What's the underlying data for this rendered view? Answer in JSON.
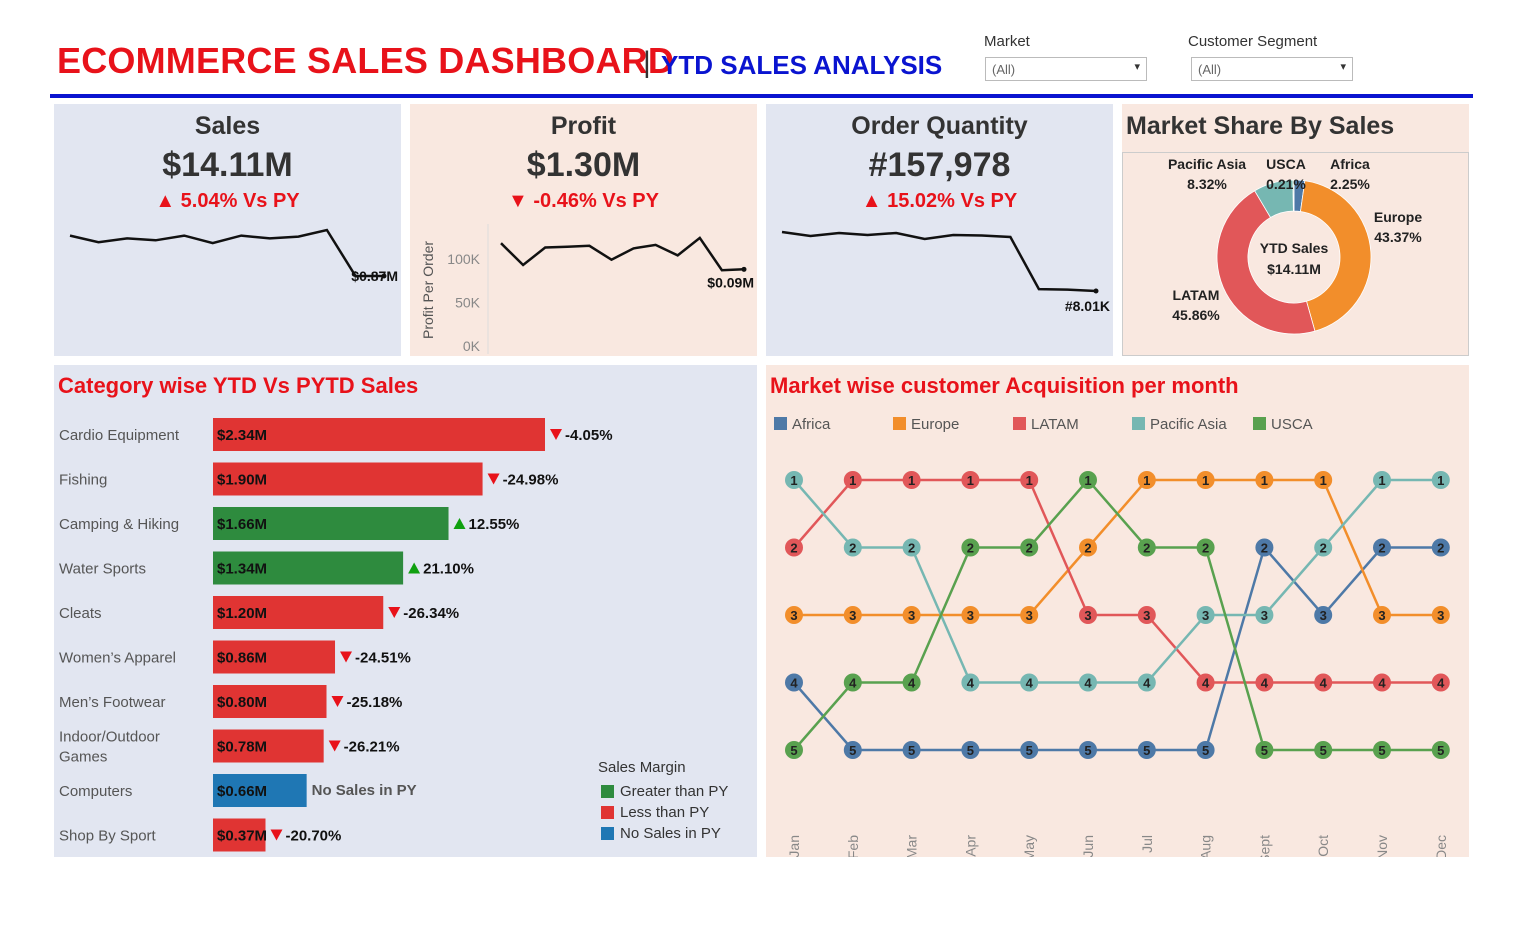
{
  "header": {
    "title": "ECOMMERCE SALES DASHBOARD",
    "separator": "|",
    "subtitle": "YTD SALES ANALYSIS"
  },
  "filters": {
    "market": {
      "label": "Market",
      "value": "(All)"
    },
    "segment": {
      "label": "Customer Segment",
      "value": "(All)"
    }
  },
  "kpis": {
    "sales": {
      "title": "Sales",
      "value": "$14.11M",
      "delta": "▲ 5.04% Vs PY",
      "end_label": "$0.87M"
    },
    "profit": {
      "title": "Profit",
      "value": "$1.30M",
      "delta": "▼ -0.46% Vs PY",
      "end_label": "$0.09M",
      "axis_title": "Profit Per Order",
      "ticks": [
        "100K",
        "50K",
        "0K"
      ]
    },
    "orders": {
      "title": "Order Quantity",
      "value": "#157,978",
      "delta": "▲ 15.02% Vs PY",
      "end_label": "#8.01K"
    }
  },
  "market_share": {
    "title": "Market Share By Sales",
    "center_line1": "YTD Sales",
    "center_line2": "$14.11M"
  },
  "category": {
    "title": "Category wise YTD Vs PYTD Sales",
    "legend_title": "Sales Margin",
    "legend": [
      {
        "label": "Greater than PY",
        "color": "#2e8b3e"
      },
      {
        "label": "Less than PY",
        "color": "#e03433"
      },
      {
        "label": "No Sales in PY",
        "color": "#1f77b4"
      }
    ]
  },
  "acquisition": {
    "title": "Market wise customer Acquisition per month"
  },
  "chart_data": [
    {
      "type": "line",
      "name": "sales_sparkline",
      "x": [
        "Jan",
        "Feb",
        "Mar",
        "Apr",
        "May",
        "Jun",
        "Jul",
        "Aug",
        "Sept",
        "Oct",
        "Nov",
        "Dec"
      ],
      "values": [
        1.3,
        1.23,
        1.27,
        1.25,
        1.3,
        1.22,
        1.3,
        1.27,
        1.29,
        1.36,
        0.87,
        0.87
      ],
      "end_label": "$0.87M"
    },
    {
      "type": "line",
      "name": "profit_sparkline",
      "x": [
        "Jan",
        "Feb",
        "Mar",
        "Apr",
        "May",
        "Jun",
        "Jul",
        "Aug",
        "Sept",
        "Oct",
        "Nov",
        "Dec"
      ],
      "values": [
        118,
        93,
        113,
        114,
        115,
        99,
        112,
        116,
        104,
        124,
        87,
        88
      ],
      "ylim": [
        0,
        140
      ],
      "ylabel": "Profit Per Order",
      "yticks": [
        0,
        50,
        100
      ],
      "end_label": "$0.09M"
    },
    {
      "type": "line",
      "name": "orders_sparkline",
      "x": [
        "Jan",
        "Feb",
        "Mar",
        "Apr",
        "May",
        "Jun",
        "Jul",
        "Aug",
        "Sept",
        "Oct",
        "Nov",
        "Dec"
      ],
      "values": [
        13.9,
        13.5,
        13.8,
        13.6,
        13.8,
        13.2,
        13.6,
        13.55,
        13.4,
        8.2,
        8.15,
        8.01
      ],
      "end_label": "#8.01K"
    },
    {
      "type": "pie",
      "name": "market_share",
      "title": "Market Share By Sales",
      "slices": [
        {
          "label": "Africa",
          "value": 2.25,
          "text": "2.25%",
          "color": "#4e79a7"
        },
        {
          "label": "Europe",
          "value": 43.37,
          "text": "43.37%",
          "color": "#f28e2b"
        },
        {
          "label": "LATAM",
          "value": 45.86,
          "text": "45.86%",
          "color": "#e15759"
        },
        {
          "label": "Pacific Asia",
          "value": 8.32,
          "text": "8.32%",
          "color": "#76b7b2"
        },
        {
          "label": "USCA",
          "value": 0.21,
          "text": "0.21%",
          "color": "#59a14f"
        }
      ]
    },
    {
      "type": "bar",
      "name": "category_sales",
      "title": "Category wise YTD Vs PYTD Sales",
      "categories": [
        "Cardio Equipment",
        "Fishing",
        "Camping & Hiking",
        "Water Sports",
        "Cleats",
        "Women’s Apparel",
        "Men’s Footwear",
        "Indoor/Outdoor Games",
        "Computers",
        "Shop By Sport"
      ],
      "values": [
        2.34,
        1.9,
        1.66,
        1.34,
        1.2,
        0.86,
        0.8,
        0.78,
        0.66,
        0.37
      ],
      "value_labels": [
        "$2.34M",
        "$1.90M",
        "$1.66M",
        "$1.34M",
        "$1.20M",
        "$0.86M",
        "$0.80M",
        "$0.78M",
        "$0.66M",
        "$0.37M"
      ],
      "change_labels": [
        "-4.05%",
        "-24.98%",
        "12.55%",
        "21.10%",
        "-26.34%",
        "-24.51%",
        "-25.18%",
        "-26.21%",
        "No Sales in PY",
        "-20.70%"
      ],
      "margin": [
        "less",
        "less",
        "greater",
        "greater",
        "less",
        "less",
        "less",
        "less",
        "none",
        "less"
      ]
    },
    {
      "type": "line",
      "name": "market_rank_bump",
      "title": "Market wise customer Acquisition per month",
      "x": [
        "Jan",
        "Feb",
        "Mar",
        "Apr",
        "May",
        "Jun",
        "Jul",
        "Aug",
        "Sept",
        "Oct",
        "Nov",
        "Dec"
      ],
      "series": [
        {
          "name": "Africa",
          "color": "#4e79a7",
          "values": [
            4,
            5,
            5,
            5,
            5,
            5,
            5,
            5,
            2,
            3,
            2,
            2
          ]
        },
        {
          "name": "Europe",
          "color": "#f28e2b",
          "values": [
            3,
            3,
            3,
            3,
            3,
            2,
            1,
            1,
            1,
            1,
            3,
            3
          ]
        },
        {
          "name": "LATAM",
          "color": "#e15759",
          "values": [
            2,
            1,
            1,
            1,
            1,
            3,
            3,
            4,
            4,
            4,
            4,
            4
          ]
        },
        {
          "name": "Pacific Asia",
          "color": "#76b7b2",
          "values": [
            1,
            2,
            2,
            4,
            4,
            4,
            4,
            3,
            3,
            2,
            1,
            1
          ]
        },
        {
          "name": "USCA",
          "color": "#59a14f",
          "values": [
            5,
            4,
            4,
            2,
            2,
            1,
            2,
            2,
            5,
            5,
            5,
            5
          ]
        }
      ]
    }
  ]
}
